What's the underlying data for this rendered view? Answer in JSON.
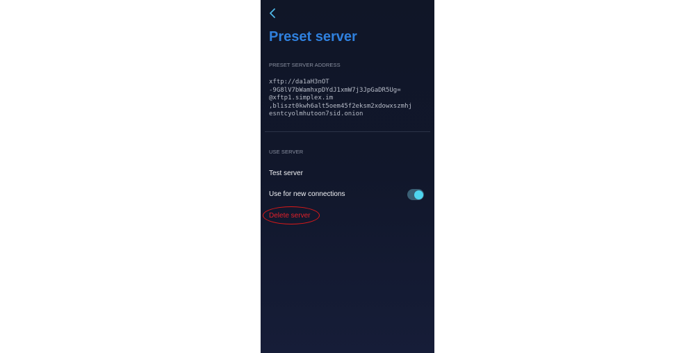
{
  "header": {
    "back_icon": "chevron-left-icon",
    "title": "Preset server"
  },
  "address_section": {
    "header": "PRESET SERVER ADDRESS",
    "lines": [
      "xftp://da1aH3nOT",
      "-9G8lV7bWamhxpDYdJ1xmW7j3JpGaDR5Ug=",
      "@xftp1.simplex.im",
      ",bliszt0kwh6alt5oem45f2eksm2xdowxszmhj",
      "esntcyolmhutoon7sid.onion"
    ]
  },
  "use_section": {
    "header": "USE SERVER",
    "test_label": "Test server",
    "new_connections_label": "Use for new connections",
    "new_connections_enabled": true,
    "delete_label": "Delete server"
  },
  "colors": {
    "accent": "#2f80de",
    "toggle_on": "#4fd6f0",
    "danger": "#e5202a"
  }
}
